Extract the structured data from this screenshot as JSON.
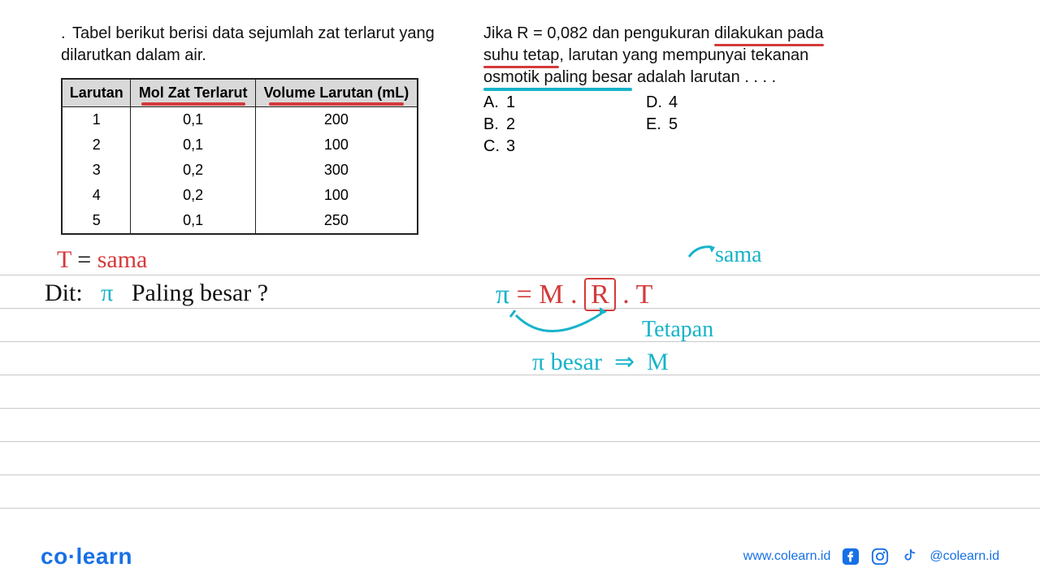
{
  "problem": {
    "intro": "Tabel berikut berisi data sejumlah zat terlarut yang dilarutkan dalam air.",
    "table": {
      "headers": [
        "Larutan",
        "Mol Zat Terlarut",
        "Volume Larutan (mL)"
      ],
      "rows": [
        {
          "larutan": "1",
          "mol": "0,1",
          "vol": "200"
        },
        {
          "larutan": "2",
          "mol": "0,1",
          "vol": "100"
        },
        {
          "larutan": "3",
          "mol": "0,2",
          "vol": "300"
        },
        {
          "larutan": "4",
          "mol": "0,2",
          "vol": "100"
        },
        {
          "larutan": "5",
          "mol": "0,1",
          "vol": "250"
        }
      ]
    },
    "question_parts": {
      "p1": "Jika R = 0,082 dan pengukuran ",
      "p2": "dilakukan pada",
      "p3": "suhu tetap",
      "p4": ", larutan yang mempunyai tekanan ",
      "p5": "osmotik paling besar",
      "p6": " adalah larutan . . . ."
    },
    "options": {
      "A": "1",
      "B": "2",
      "C": "3",
      "D": "4",
      "E": "5"
    }
  },
  "handwriting": {
    "t_sama_T": "T",
    "t_sama_eq": " = ",
    "t_sama_val": "sama",
    "dit_label": "Dit:",
    "dit_pi": "π",
    "dit_text": "Paling besar ?",
    "sama2": "sama",
    "formula_pi": "π",
    "formula_eq": " = M .",
    "formula_R": "R",
    "formula_dot": ".",
    "formula_T": "T",
    "tetapan": "Tetapan",
    "pi2": "π",
    "besar": " besar",
    "imply": " ⇒ ",
    "arrowM": "M"
  },
  "footer": {
    "brand1": "co",
    "brand2": "learn",
    "url": "www.colearn.id",
    "handle": "@colearn.id"
  }
}
